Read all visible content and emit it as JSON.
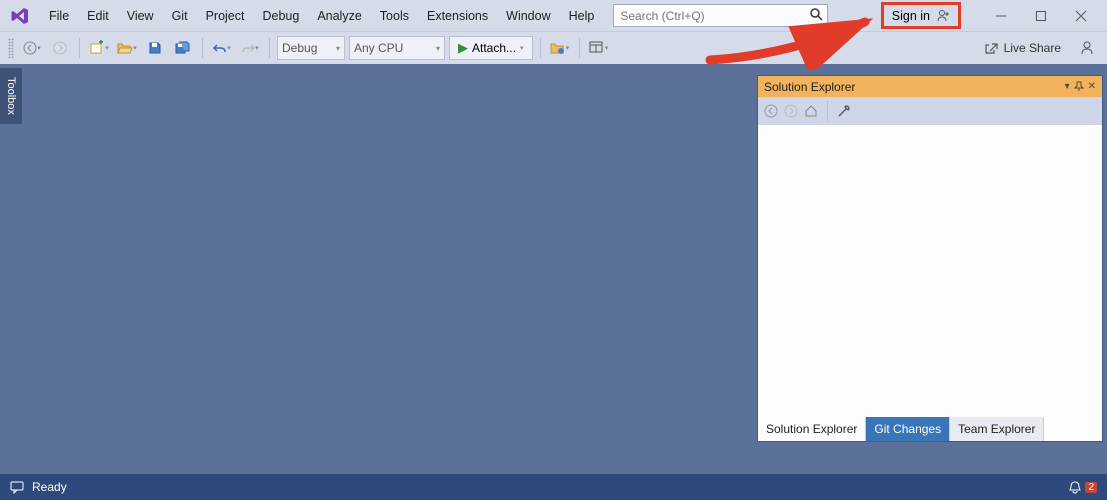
{
  "menu": [
    "File",
    "Edit",
    "View",
    "Git",
    "Project",
    "Debug",
    "Analyze",
    "Tools",
    "Extensions",
    "Window",
    "Help"
  ],
  "search": {
    "placeholder": "Search (Ctrl+Q)"
  },
  "signin_label": "Sign in",
  "toolbar": {
    "config": "Debug",
    "platform": "Any CPU",
    "attach": "Attach..."
  },
  "live_share": "Live Share",
  "toolbox_label": "Toolbox",
  "solution_explorer": {
    "title": "Solution Explorer",
    "tabs": [
      "Solution Explorer",
      "Git Changes",
      "Team Explorer"
    ]
  },
  "status": {
    "ready": "Ready",
    "notif_count": "2"
  }
}
